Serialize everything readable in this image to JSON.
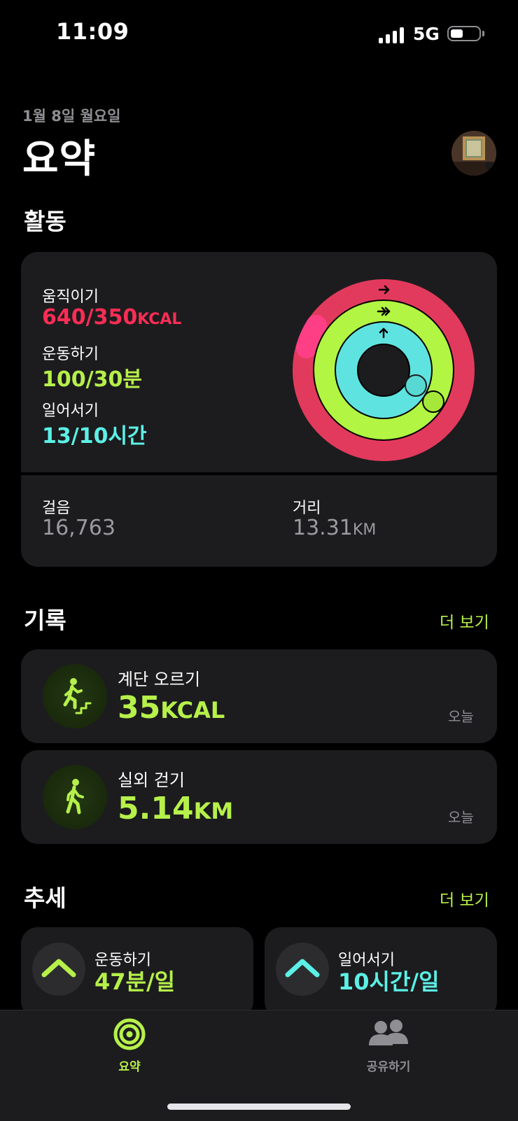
{
  "status_bar": {
    "time": "11:09",
    "network": "5G",
    "battery_level": 0.45
  },
  "header": {
    "date": "1월 8일 월요일",
    "title": "요약"
  },
  "activity": {
    "section_title": "활동",
    "move": {
      "label": "움직이기",
      "value": "640/350",
      "unit": "KCAL",
      "color": "#fa2d55",
      "progress": 1.83
    },
    "exercise": {
      "label": "운동하기",
      "value": "100/30분",
      "color": "#b6f04a",
      "progress": 3.33
    },
    "stand": {
      "label": "일어서기",
      "value": "13/10시간",
      "color": "#5cf0e6",
      "progress": 1.3
    },
    "steps": {
      "label": "걸음",
      "value": "16,763"
    },
    "distance": {
      "label": "거리",
      "value": "13.31",
      "unit": "KM"
    }
  },
  "records": {
    "section_title": "기록",
    "see_more": "더 보기",
    "items": [
      {
        "title": "계단 오르기",
        "value": "35",
        "unit": "KCAL",
        "when": "오늘",
        "icon": "stair-climbing-icon"
      },
      {
        "title": "실외 걷기",
        "value": "5.14",
        "unit": "KM",
        "when": "오늘",
        "icon": "walking-icon"
      }
    ]
  },
  "trends": {
    "section_title": "추세",
    "see_more": "더 보기",
    "items": [
      {
        "label": "운동하기",
        "value": "47분/일",
        "color": "#b6f04a",
        "icon": "chevron-up-icon"
      },
      {
        "label": "일어서기",
        "value": "10시간/일",
        "color": "#5cf0e6",
        "icon": "chevron-up-icon"
      }
    ]
  },
  "tabbar": {
    "tabs": [
      {
        "label": "요약",
        "active": true,
        "icon": "summary-rings-icon"
      },
      {
        "label": "공유하기",
        "active": false,
        "icon": "sharing-people-icon"
      }
    ],
    "active_color": "#b6f04a",
    "inactive_color": "#8e8e93"
  }
}
